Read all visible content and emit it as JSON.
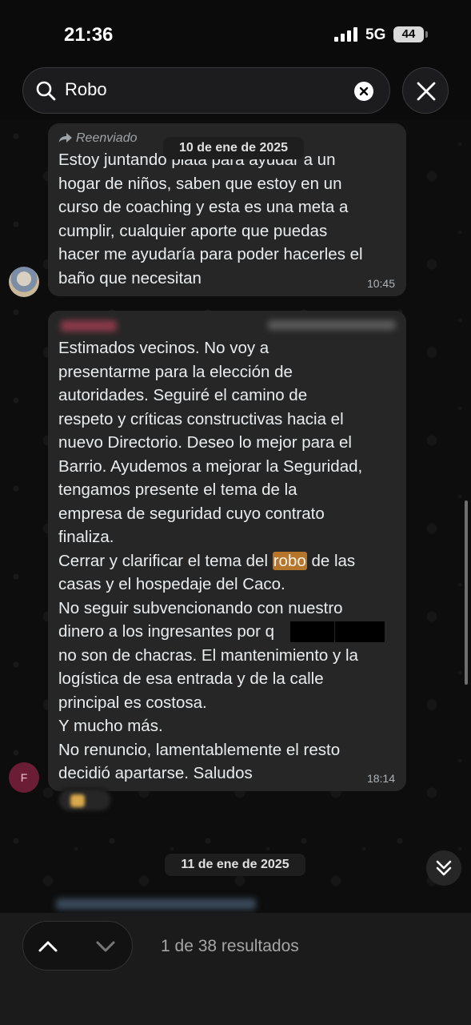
{
  "status_bar": {
    "time": "21:36",
    "network": "5G",
    "battery": "44"
  },
  "search": {
    "query": "Robo"
  },
  "chat": {
    "date_separators": [
      "10 de ene de 2025",
      "11 de ene de 2025"
    ],
    "messages": [
      {
        "forwarded_label": "Reenviado",
        "text": "Estoy juntando plata para ayudar a un\nhogar de niños, saben que estoy en un\ncurso de coaching y esta es una meta a\ncumplir, cualquier aporte que puedas\nhacer me ayudaría para poder hacerles el\nbaño que necesitan",
        "time": "10:45"
      },
      {
        "avatar_letter": "F",
        "text_before_match": "Estimados vecinos. No voy a\npresentarme para la elección de\nautoridades. Seguiré el camino de\nrespeto y críticas constructivas hacia el\nnuevo Directorio. Deseo lo mejor para el\nBarrio. Ayudemos a mejorar la Seguridad,\ntengamos presente el tema de la\nempresa de seguridad cuyo contrato\nfinaliza.\nCerrar y clarificar el tema del ",
        "match": "robo",
        "text_after_match": " de las\ncasas y el hospedaje del Caco.\nNo seguir subvencionando con nuestro\ndinero a los ingresantes  por                         q\nno son de chacras. El mantenimiento y la\nlogística de esa entrada y de la calle\nprincipal es costosa.\nY mucho más.\nNo renuncio, lamentablemente el resto\ndecidió apartarse. Saludos",
        "time": "18:14"
      }
    ]
  },
  "bottom": {
    "results_label": "1 de 38 resultados"
  },
  "colors": {
    "bubble": "#262626",
    "highlight": "#b5752a",
    "background": "#0b0b0b"
  }
}
